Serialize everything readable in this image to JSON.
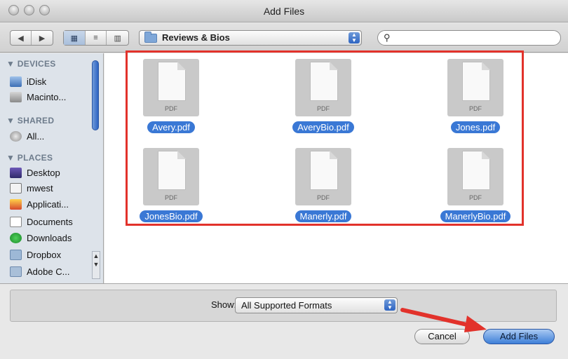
{
  "window": {
    "title": "Add Files"
  },
  "toolbar": {
    "nav_back": "◀",
    "nav_forward": "▶",
    "view_icons": "▦",
    "view_list": "≡",
    "view_columns": "▥",
    "location": "Reviews & Bios",
    "search_value": "",
    "search_glyph": "🔍"
  },
  "sidebar": {
    "devices_header": "▼ DEVICES",
    "shared_header": "▼ SHARED",
    "places_header": "▼ PLACES",
    "devices": [
      {
        "label": "iDisk",
        "icon": "idisk-icon"
      },
      {
        "label": "Macinto...",
        "icon": "hard-drive-icon"
      }
    ],
    "shared": [
      {
        "label": "All...",
        "icon": "shared-network-icon"
      }
    ],
    "places": [
      {
        "label": "Desktop",
        "icon": "desktop-icon"
      },
      {
        "label": "mwest",
        "icon": "home-icon"
      },
      {
        "label": "Applicati...",
        "icon": "applications-icon"
      },
      {
        "label": "Documents",
        "icon": "documents-icon"
      },
      {
        "label": "Downloads",
        "icon": "downloads-icon"
      },
      {
        "label": "Dropbox",
        "icon": "dropbox-icon"
      },
      {
        "label": "Adobe C...",
        "icon": "folder-icon"
      }
    ]
  },
  "files": [
    {
      "name": "Avery.pdf",
      "type_label": "PDF",
      "selected": true
    },
    {
      "name": "AveryBio.pdf",
      "type_label": "PDF",
      "selected": true
    },
    {
      "name": "Jones.pdf",
      "type_label": "PDF",
      "selected": true
    },
    {
      "name": "JonesBio.pdf",
      "type_label": "PDF",
      "selected": true
    },
    {
      "name": "Manerly.pdf",
      "type_label": "PDF",
      "selected": true
    },
    {
      "name": "ManerlyBio.pdf",
      "type_label": "PDF",
      "selected": true
    }
  ],
  "filter": {
    "show_label": "Show:",
    "format_value": "All Supported Formats"
  },
  "buttons": {
    "cancel": "Cancel",
    "add_files": "Add Files"
  },
  "colors": {
    "selection": "#3a78d5",
    "annotation_red": "#e2322b",
    "default_button": "#3e7fd8"
  }
}
